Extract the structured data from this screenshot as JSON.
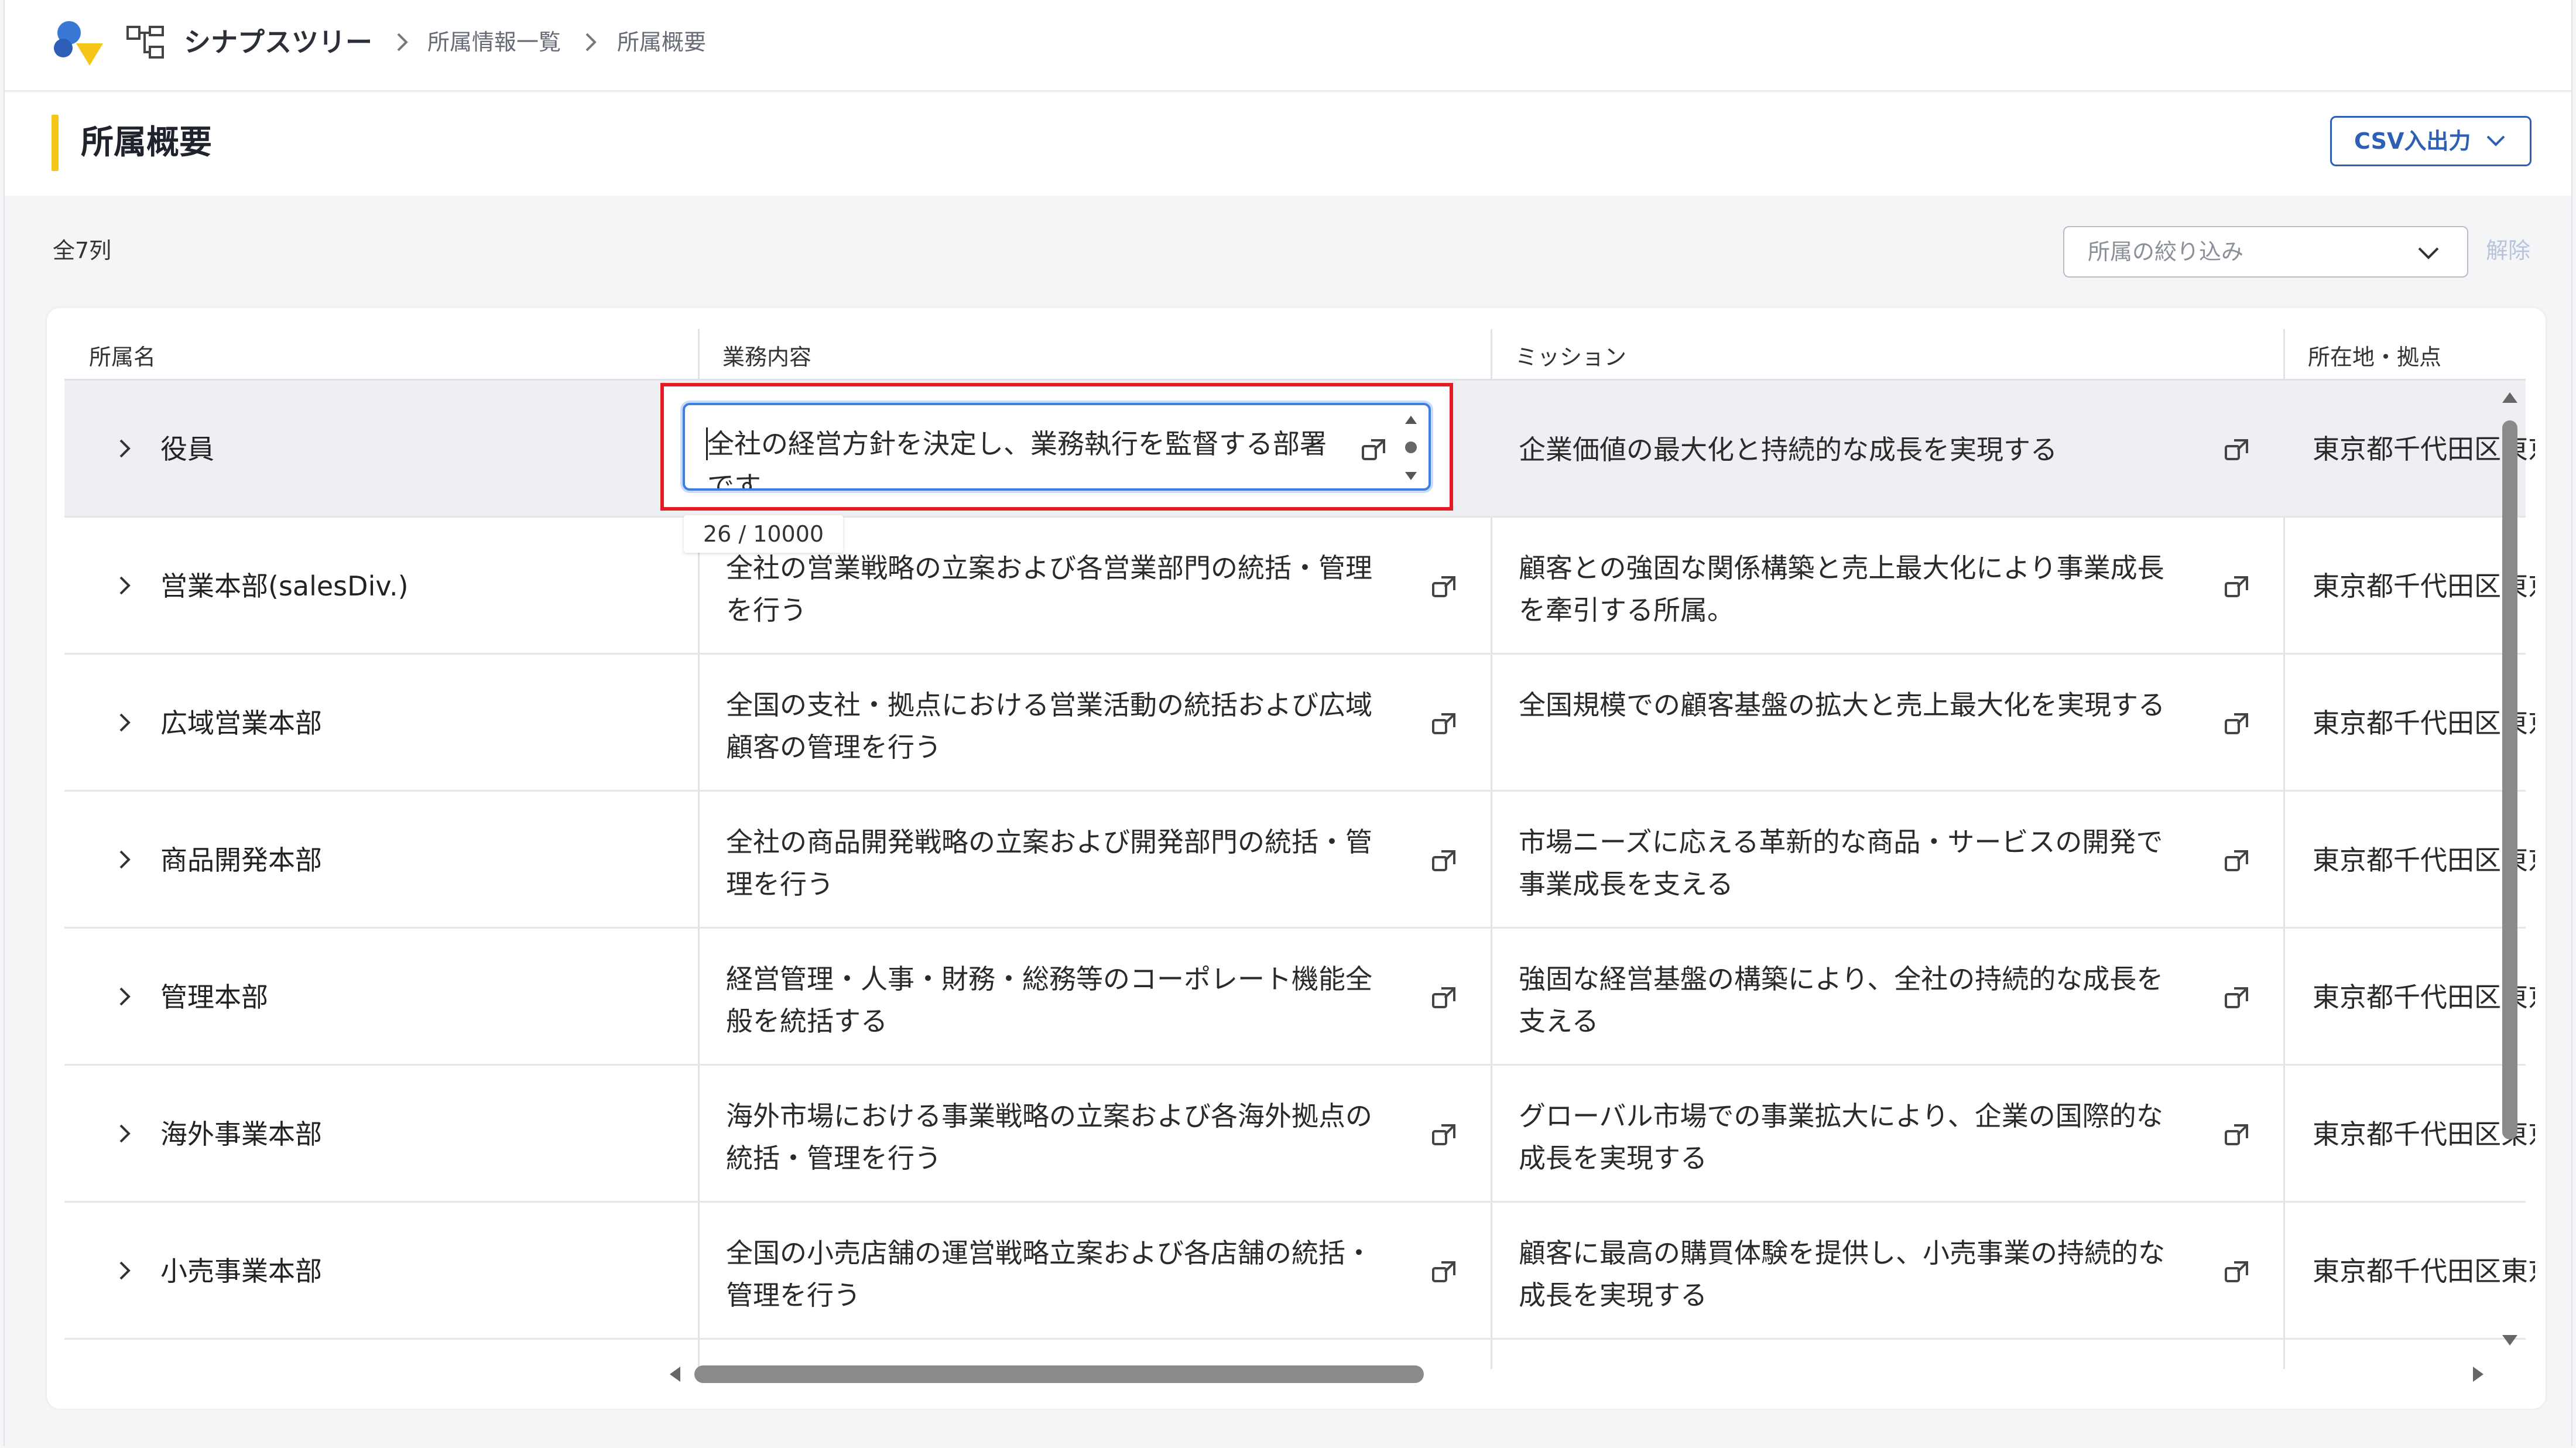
{
  "header": {
    "app_name": "シナプスツリー",
    "breadcrumb": [
      "所属情報一覧",
      "所属概要"
    ]
  },
  "page": {
    "title": "所属概要",
    "csv_button": "CSV入出力",
    "count_label": "全7列",
    "filter_placeholder": "所属の絞り込み",
    "clear_label": "解除"
  },
  "table": {
    "columns": [
      "所属名",
      "業務内容",
      "ミッション",
      "所在地・拠点"
    ],
    "rows": [
      {
        "name": "役員",
        "business": "全社の経営方針を決定し、業務執行を監督する部署です",
        "mission": "企業価値の最大化と持続的な成長を実現する",
        "location": "東京都千代田区東京"
      },
      {
        "name": "営業本部(salesDiv.)",
        "business": "全社の営業戦略の立案および各営業部門の統括・管理を行う",
        "mission": "顧客との強固な関係構築と売上最大化により事業成長を牽引する所属。",
        "location": "東京都千代田区東京"
      },
      {
        "name": "広域営業本部",
        "business": "全国の支社・拠点における営業活動の統括および広域顧客の管理を行う",
        "mission": "全国規模での顧客基盤の拡大と売上最大化を実現する",
        "location": "東京都千代田区東京"
      },
      {
        "name": "商品開発本部",
        "business": "全社の商品開発戦略の立案および開発部門の統括・管理を行う",
        "mission": "市場ニーズに応える革新的な商品・サービスの開発で事業成長を支える",
        "location": "東京都千代田区東京"
      },
      {
        "name": "管理本部",
        "business": "経営管理・人事・財務・総務等のコーポレート機能全般を統括する",
        "mission": "強固な経営基盤の構築により、全社の持続的な成長を支える",
        "location": "東京都千代田区東京"
      },
      {
        "name": "海外事業本部",
        "business": "海外市場における事業戦略の立案および各海外拠点の統括・管理を行う",
        "mission": "グローバル市場での事業拡大により、企業の国際的な成長を実現する",
        "location": "東京都千代田区東京"
      },
      {
        "name": "小売事業本部",
        "business": "全国の小売店舗の運営戦略立案および各店舗の統括・管理を行う",
        "mission": "顧客に最高の購買体験を提供し、小売事業の持続的な成長を実現する",
        "location": "東京都千代田区東京"
      }
    ],
    "editing": {
      "value": "全社の経営方針を決定し、業務執行を監督する部署です",
      "char_count": "26 / 10000"
    }
  },
  "colors": {
    "accent": "#f5c518",
    "primary": "#2d5fb4",
    "highlight_border": "#e41b23",
    "focus_border": "#3b7fe0"
  }
}
